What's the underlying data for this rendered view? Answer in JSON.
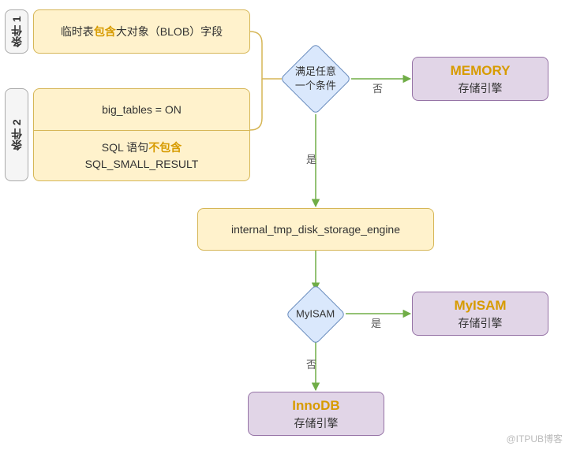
{
  "condition1": {
    "label": "条件 1",
    "text_pre": "临时表",
    "text_hi": "包含",
    "text_post": "大对象（BLOB）字段"
  },
  "condition2": {
    "label": "条件 2",
    "row1": "big_tables = ON",
    "row2_pre": "SQL 语句",
    "row2_hi": "不包含",
    "row2_post": "",
    "row3": "SQL_SMALL_RESULT"
  },
  "decision1": {
    "line1": "满足任意",
    "line2": "一个条件"
  },
  "process": "internal_tmp_disk_storage_engine",
  "decision2": "MyISAM",
  "edge": {
    "yes": "是",
    "no": "否"
  },
  "result_memory": {
    "title": "MEMORY",
    "sub": "存储引擎"
  },
  "result_myisam": {
    "title": "MyISAM",
    "sub": "存储引擎"
  },
  "result_innodb": {
    "title": "InnoDB",
    "sub": "存储引擎"
  },
  "watermark": "@ITPUB博客",
  "chart_data": {
    "type": "flowchart",
    "nodes": [
      {
        "id": "c1",
        "kind": "condition-group",
        "label": "条件 1",
        "items": [
          "临时表包含大对象（BLOB）字段"
        ]
      },
      {
        "id": "c2",
        "kind": "condition-group",
        "label": "条件 2",
        "items": [
          "big_tables = ON",
          "SQL 语句不包含 SQL_SMALL_RESULT"
        ]
      },
      {
        "id": "d1",
        "kind": "decision",
        "text": "满足任意一个条件"
      },
      {
        "id": "r_memory",
        "kind": "terminal",
        "title": "MEMORY",
        "sub": "存储引擎"
      },
      {
        "id": "p1",
        "kind": "process",
        "text": "internal_tmp_disk_storage_engine"
      },
      {
        "id": "d2",
        "kind": "decision",
        "text": "MyISAM"
      },
      {
        "id": "r_myisam",
        "kind": "terminal",
        "title": "MyISAM",
        "sub": "存储引擎"
      },
      {
        "id": "r_innodb",
        "kind": "terminal",
        "title": "InnoDB",
        "sub": "存储引擎"
      }
    ],
    "edges": [
      {
        "from": "c1",
        "to": "d1"
      },
      {
        "from": "c2",
        "to": "d1"
      },
      {
        "from": "d1",
        "to": "r_memory",
        "label": "否"
      },
      {
        "from": "d1",
        "to": "p1",
        "label": "是"
      },
      {
        "from": "p1",
        "to": "d2"
      },
      {
        "from": "d2",
        "to": "r_myisam",
        "label": "是"
      },
      {
        "from": "d2",
        "to": "r_innodb",
        "label": "否"
      }
    ]
  }
}
